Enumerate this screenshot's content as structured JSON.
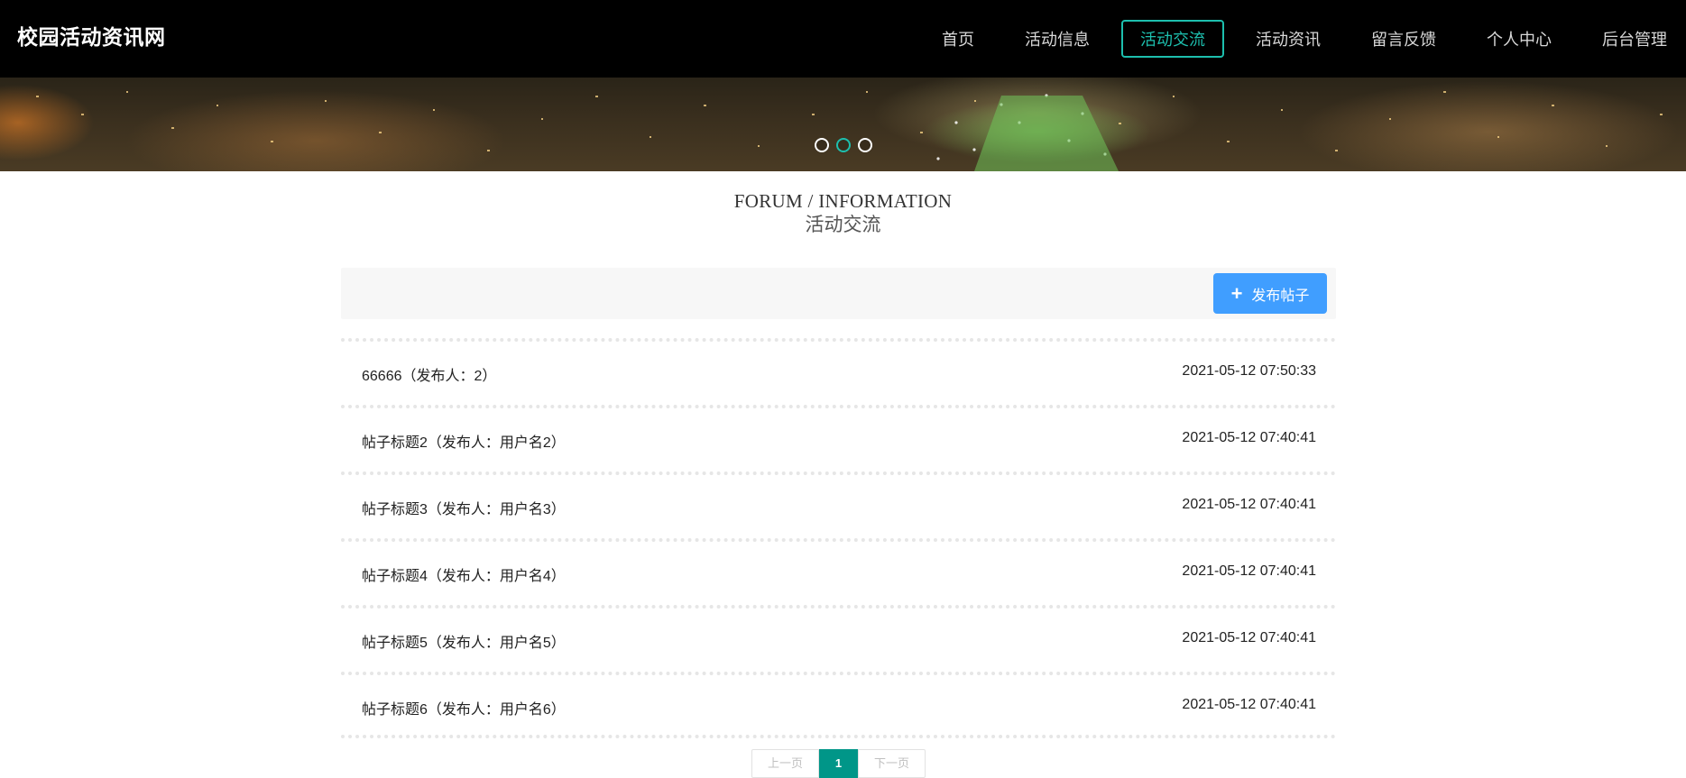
{
  "header": {
    "site_title": "校园活动资讯网",
    "nav": [
      {
        "label": "首页",
        "active": false
      },
      {
        "label": "活动信息",
        "active": false
      },
      {
        "label": "活动交流",
        "active": true
      },
      {
        "label": "活动资讯",
        "active": false
      },
      {
        "label": "留言反馈",
        "active": false
      },
      {
        "label": "个人中心",
        "active": false
      },
      {
        "label": "后台管理",
        "active": false
      }
    ]
  },
  "banner": {
    "slide_count": 3,
    "active_slide": 2
  },
  "section": {
    "title_en": "FORUM / INFORMATION",
    "title_cn": "活动交流"
  },
  "toolbar": {
    "publish_label": "发布帖子",
    "publish_icon": "plus-icon"
  },
  "posts": [
    {
      "title": "66666（发布人：2）",
      "time": "2021-05-12 07:50:33"
    },
    {
      "title": "帖子标题2（发布人：用户名2）",
      "time": "2021-05-12 07:40:41"
    },
    {
      "title": "帖子标题3（发布人：用户名3）",
      "time": "2021-05-12 07:40:41"
    },
    {
      "title": "帖子标题4（发布人：用户名4）",
      "time": "2021-05-12 07:40:41"
    },
    {
      "title": "帖子标题5（发布人：用户名5）",
      "time": "2021-05-12 07:40:41"
    },
    {
      "title": "帖子标题6（发布人：用户名6）",
      "time": "2021-05-12 07:40:41"
    }
  ],
  "pagination": {
    "prev_label": "上一页",
    "current_page": "1",
    "next_label": "下一页"
  },
  "colors": {
    "accent_teal": "#1dbfae",
    "publish_blue": "#409eff",
    "page_active": "#009688",
    "topbar_bg": "#000000"
  }
}
